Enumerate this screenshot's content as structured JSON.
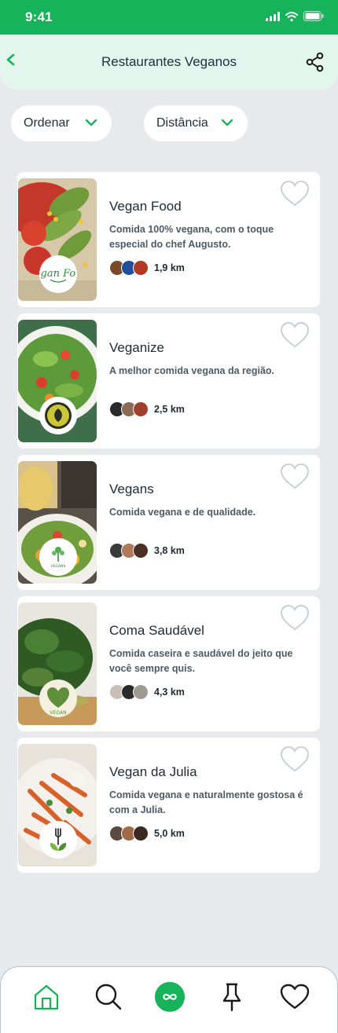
{
  "status": {
    "time": "9:41"
  },
  "header": {
    "title": "Restaurantes Veganos"
  },
  "filters": {
    "order": "Ordenar",
    "distance": "Distância"
  },
  "restaurants": [
    {
      "name": "Vegan Food",
      "description": "Comida 100% vegana, com o toque especial do chef Augusto.",
      "distance": "1,9 km",
      "logo_text": "Vegan Food"
    },
    {
      "name": "Veganize",
      "description": "A melhor comida vegana da região.",
      "distance": "2,5 km",
      "logo_text": ""
    },
    {
      "name": "Vegans",
      "description": "Comida vegana e de qualidade.",
      "distance": "3,8 km",
      "logo_text": "VEGANS"
    },
    {
      "name": "Coma Saudável",
      "description": "Comida caseira e saudável do jeito que você sempre quis.",
      "distance": "4,3 km",
      "logo_text": "VEGAN"
    },
    {
      "name": "Vegan da Julia",
      "description": "Comida vegana e naturalmente gostosa é com a Julia.",
      "distance": "5,0 km",
      "logo_text": ""
    }
  ],
  "colors": {
    "brand_green": "#16b35a",
    "header_bg": "#e3f6ee",
    "page_bg": "#e6eaed"
  },
  "nav": {
    "items": [
      "home-icon",
      "search-icon",
      "infinity-icon",
      "pin-icon",
      "heart-icon"
    ],
    "active": "home"
  }
}
